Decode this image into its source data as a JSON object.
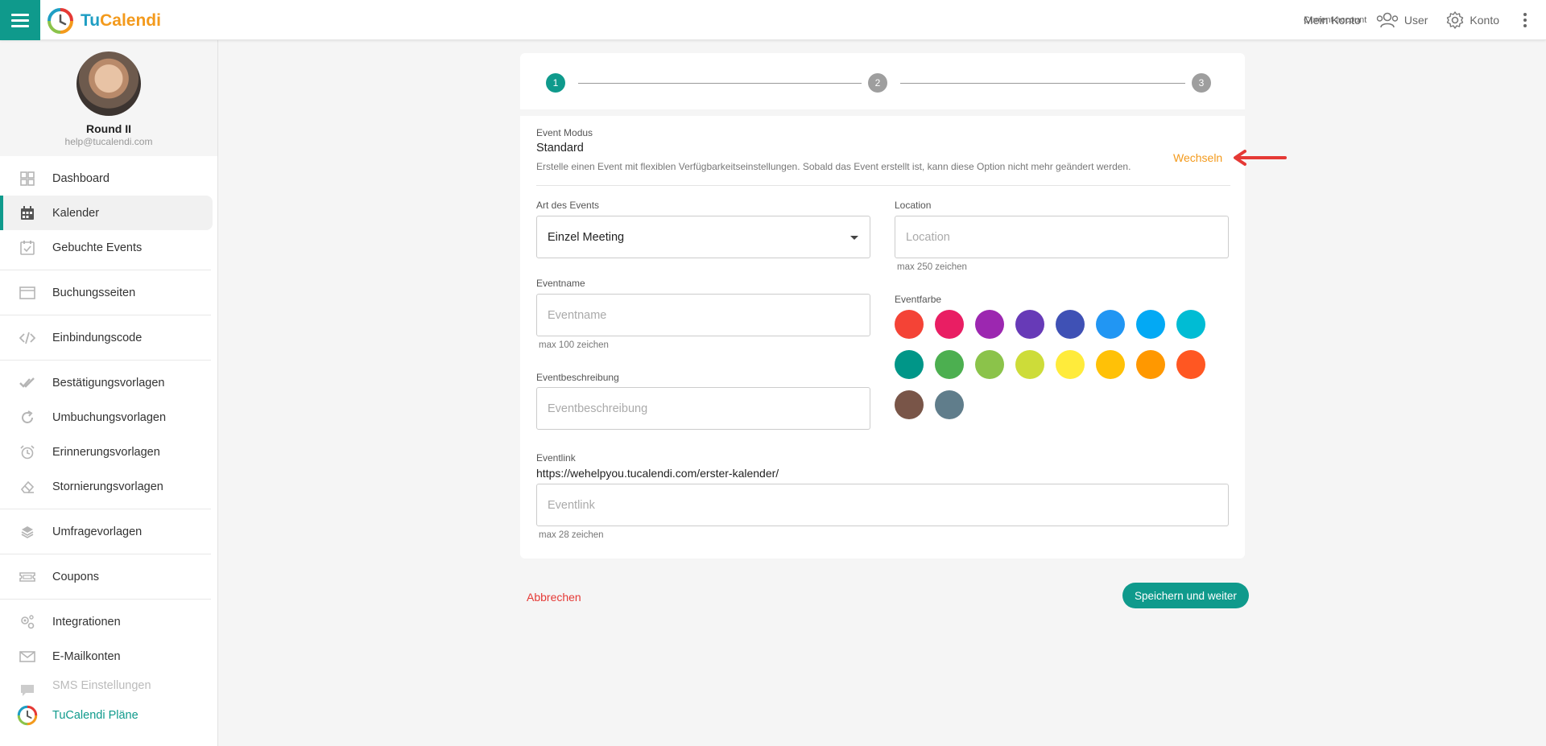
{
  "header": {
    "logo_tu": "Tu",
    "logo_cal": "Calend",
    "logo_i": "i",
    "account_label": "Current account",
    "account_value": "Mein Konto",
    "user_label": "User",
    "konto_label": "Konto"
  },
  "profile": {
    "name": "Round II",
    "email": "help@tucalendi.com"
  },
  "sidebar": {
    "items": [
      {
        "label": "Dashboard",
        "icon": "dashboard-icon"
      },
      {
        "label": "Kalender",
        "icon": "calendar-icon"
      },
      {
        "label": "Gebuchte Events",
        "icon": "calendar-check-icon"
      },
      {
        "label": "Buchungsseiten",
        "icon": "browser-window-icon"
      },
      {
        "label": "Einbindungscode",
        "icon": "code-icon"
      },
      {
        "label": "Bestätigungsvorlagen",
        "icon": "double-check-icon"
      },
      {
        "label": "Umbuchungsvorlagen",
        "icon": "refresh-icon"
      },
      {
        "label": "Erinnerungsvorlagen",
        "icon": "alarm-clock-icon"
      },
      {
        "label": "Stornierungsvorlagen",
        "icon": "eraser-icon"
      },
      {
        "label": "Umfragevorlagen",
        "icon": "layers-icon"
      },
      {
        "label": "Coupons",
        "icon": "ticket-icon"
      },
      {
        "label": "Integrationen",
        "icon": "gears-icon"
      },
      {
        "label": "E-Mailkonten",
        "icon": "envelope-icon"
      },
      {
        "label": "SMS Einstellungen",
        "icon": "sms-icon"
      },
      {
        "label": "TuCalendi Pläne",
        "icon": "tucalendi-logo-icon"
      }
    ]
  },
  "stepper": {
    "steps": [
      "1",
      "2",
      "3"
    ],
    "active": 1
  },
  "form": {
    "mode_label": "Event Modus",
    "mode_value": "Standard",
    "mode_desc": "Erstelle einen Event mit flexiblen Verfügbarkeitseinstellungen. Sobald das Event erstellt ist, kann diese Option nicht mehr geändert werden.",
    "switch_label": "Wechseln",
    "type_label": "Art des Events",
    "type_value": "Einzel Meeting",
    "location_label": "Location",
    "location_placeholder": "Location",
    "location_hint": "max 250 zeichen",
    "name_label": "Eventname",
    "name_placeholder": "Eventname",
    "name_hint": "max 100 zeichen",
    "color_label": "Eventfarbe",
    "colors": [
      "#f44336",
      "#e91e63",
      "#9c27b0",
      "#673ab7",
      "#3f51b5",
      "#2196f3",
      "#03a9f4",
      "#00bcd4",
      "#009688",
      "#4caf50",
      "#8bc34a",
      "#cddc39",
      "#ffeb3b",
      "#ffc107",
      "#ff9800",
      "#ff5722",
      "#795548",
      "#607d8b"
    ],
    "desc_label": "Eventbeschreibung",
    "desc_placeholder": "Eventbeschreibung",
    "link_label": "Eventlink",
    "link_base": "https://wehelpyou.tucalendi.com/erster-kalender/",
    "link_placeholder": "Eventlink",
    "link_hint": "max 28 zeichen"
  },
  "actions": {
    "cancel": "Abbrechen",
    "save": "Speichern und weiter"
  },
  "accent": "#0f9a8c",
  "annotation_arrow_color": "#e53935"
}
